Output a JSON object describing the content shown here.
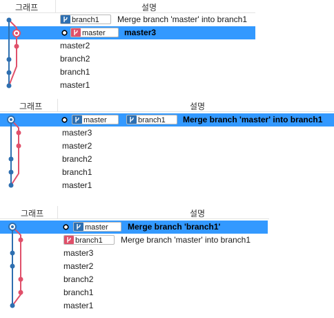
{
  "header": {
    "graph_label": "그래프",
    "desc_label": "설명"
  },
  "colors": {
    "blue_branch": "#2e6fb0",
    "pink_branch": "#e0506a",
    "selection": "#3399ff"
  },
  "panel1": {
    "rows": [
      {
        "tag": "branch1",
        "tag_color": "blue",
        "message": "Merge branch 'master' into branch1"
      },
      {
        "tag": "master",
        "tag_color": "pink",
        "message": "master3",
        "selected": true,
        "head": true
      },
      {
        "message": "master2"
      },
      {
        "message": "branch2"
      },
      {
        "message": "branch1"
      },
      {
        "message": "master1"
      }
    ]
  },
  "panel2": {
    "rows": [
      {
        "tag": "master",
        "tag2": "branch1",
        "message": "Merge branch 'master' into branch1",
        "selected": true,
        "head": true
      },
      {
        "message": "master3"
      },
      {
        "message": "master2"
      },
      {
        "message": "branch2"
      },
      {
        "message": "branch1"
      },
      {
        "message": "master1"
      }
    ]
  },
  "panel3": {
    "rows": [
      {
        "tag": "master",
        "message": "Merge branch 'branch1'",
        "selected": true,
        "head": true
      },
      {
        "tag": "branch1",
        "tag_color": "pink",
        "message": "Merge branch 'master' into branch1"
      },
      {
        "message": "master3"
      },
      {
        "message": "master2"
      },
      {
        "message": "branch2"
      },
      {
        "message": "branch1"
      },
      {
        "message": "master1"
      }
    ]
  }
}
